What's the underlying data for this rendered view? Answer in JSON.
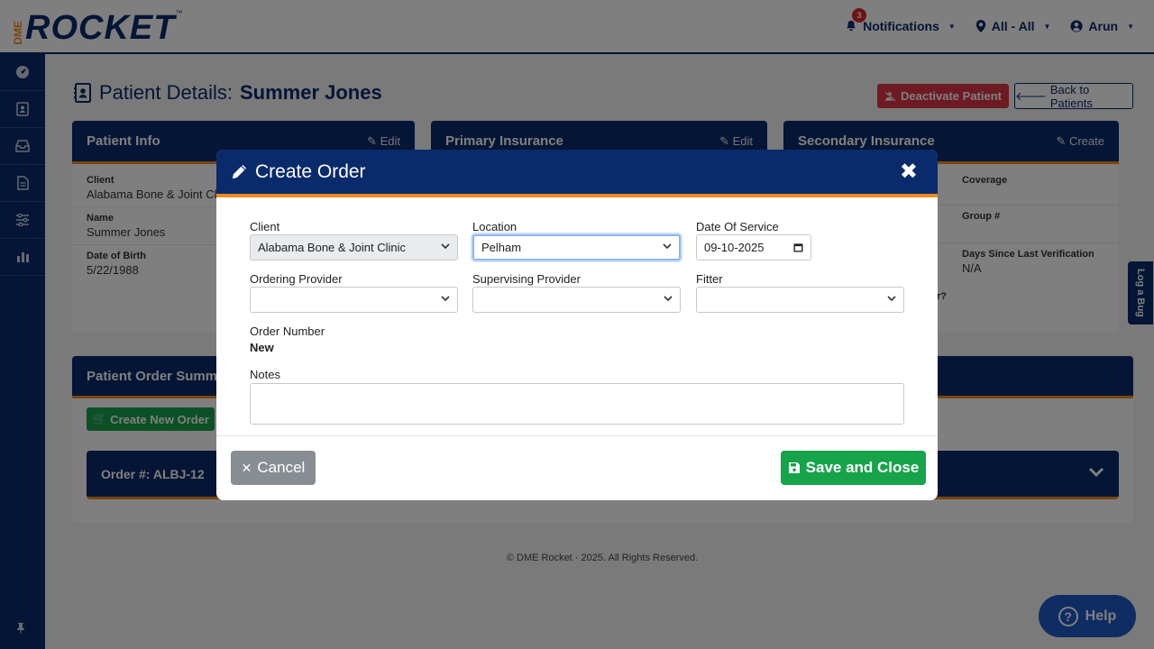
{
  "brand": {
    "dme": "DME",
    "rocket": "ROCKET",
    "tm": "™"
  },
  "topnav": {
    "notifications_count": "3",
    "notifications_label": "Notifications",
    "location_label": "All - All",
    "user_label": "Arun"
  },
  "page": {
    "title_prefix": "Patient Details:",
    "patient_name": "Summer Jones",
    "deactivate_label": "Deactivate Patient",
    "back_label": "Back to Patients"
  },
  "patient_info": {
    "title": "Patient Info",
    "edit_label": "Edit",
    "fields": [
      {
        "label": "Client",
        "value": "Alabama Bone & Joint Clinic"
      },
      {
        "label": "Name",
        "value": "Summer Jones"
      },
      {
        "label": "Date of Birth",
        "value": "5/22/1988"
      }
    ]
  },
  "primary_insurance": {
    "title": "Primary Insurance",
    "edit_label": "Edit"
  },
  "secondary_insurance": {
    "title": "Secondary Insurance",
    "create_label": "Create",
    "fields": [
      {
        "label": "Coverage",
        "value": ""
      },
      {
        "label": "Group #",
        "value": ""
      },
      {
        "label": "Days Since Last Verification",
        "value": "N/A"
      }
    ],
    "partial_text": "r?"
  },
  "order_summary": {
    "title": "Patient Order Summa",
    "create_label": "Create New Order",
    "order_label": "Order #: ALBJ-12"
  },
  "footer": {
    "text": "© DME Rocket  ·  2025. All Rights Reserved."
  },
  "log_bug_label": "Log a Bug",
  "help_label": "Help",
  "modal": {
    "title": "Create Order",
    "client_label": "Client",
    "client_value": "Alabama Bone & Joint Clinic",
    "location_label": "Location",
    "location_value": "Pelham",
    "dos_label": "Date Of Service",
    "dos_value": "09-10-2025",
    "ordering_label": "Ordering Provider",
    "ordering_value": "",
    "supervising_label": "Supervising Provider",
    "supervising_value": "",
    "fitter_label": "Fitter",
    "fitter_value": "",
    "order_number_label": "Order Number",
    "order_number_value": "New",
    "notes_label": "Notes",
    "notes_value": "",
    "cancel_label": "Cancel",
    "save_label": "Save and Close"
  },
  "colors": {
    "navy": "#0a2b6b",
    "orange": "#f28b1e",
    "green": "#16a34a",
    "red": "#dc3545"
  }
}
